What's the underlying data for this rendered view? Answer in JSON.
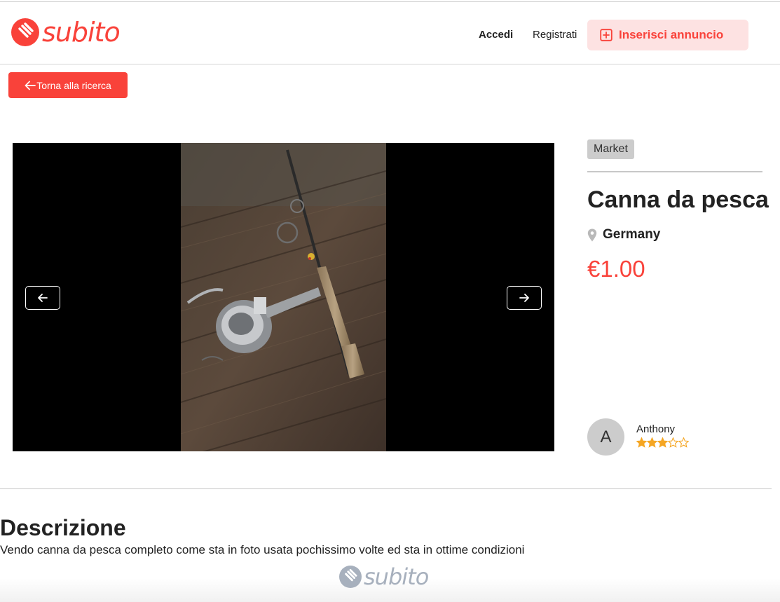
{
  "header": {
    "logo_text": "subito",
    "login_label": "Accedi",
    "register_label": "Registrati",
    "insert_ad_label": "Inserisci annuncio"
  },
  "back_button": {
    "label": "Torna alla ricerca"
  },
  "listing": {
    "category": "Market",
    "title": "Canna da pesca",
    "location": "Germany",
    "price": "€1.00"
  },
  "seller": {
    "avatar_initial": "A",
    "name": "Anthony",
    "rating": 3,
    "rating_max": 5
  },
  "description": {
    "heading": "Descrizione",
    "text": "Vendo canna da pesca completo come sta in foto usata pochissimo volte ed sta in ottime condizioni"
  },
  "footer": {
    "logo_text": "subito"
  },
  "icons": {
    "logo": "subito-logo-icon",
    "insert": "plus-square-icon",
    "back": "arrow-left-icon",
    "prev": "arrow-left-icon",
    "next": "arrow-right-icon",
    "location": "map-pin-icon",
    "star": "star-icon"
  },
  "colors": {
    "brand": "#f9423a",
    "brand_light": "#fde2e2",
    "star": "#f5a623",
    "badge_bg": "#cccccc"
  }
}
